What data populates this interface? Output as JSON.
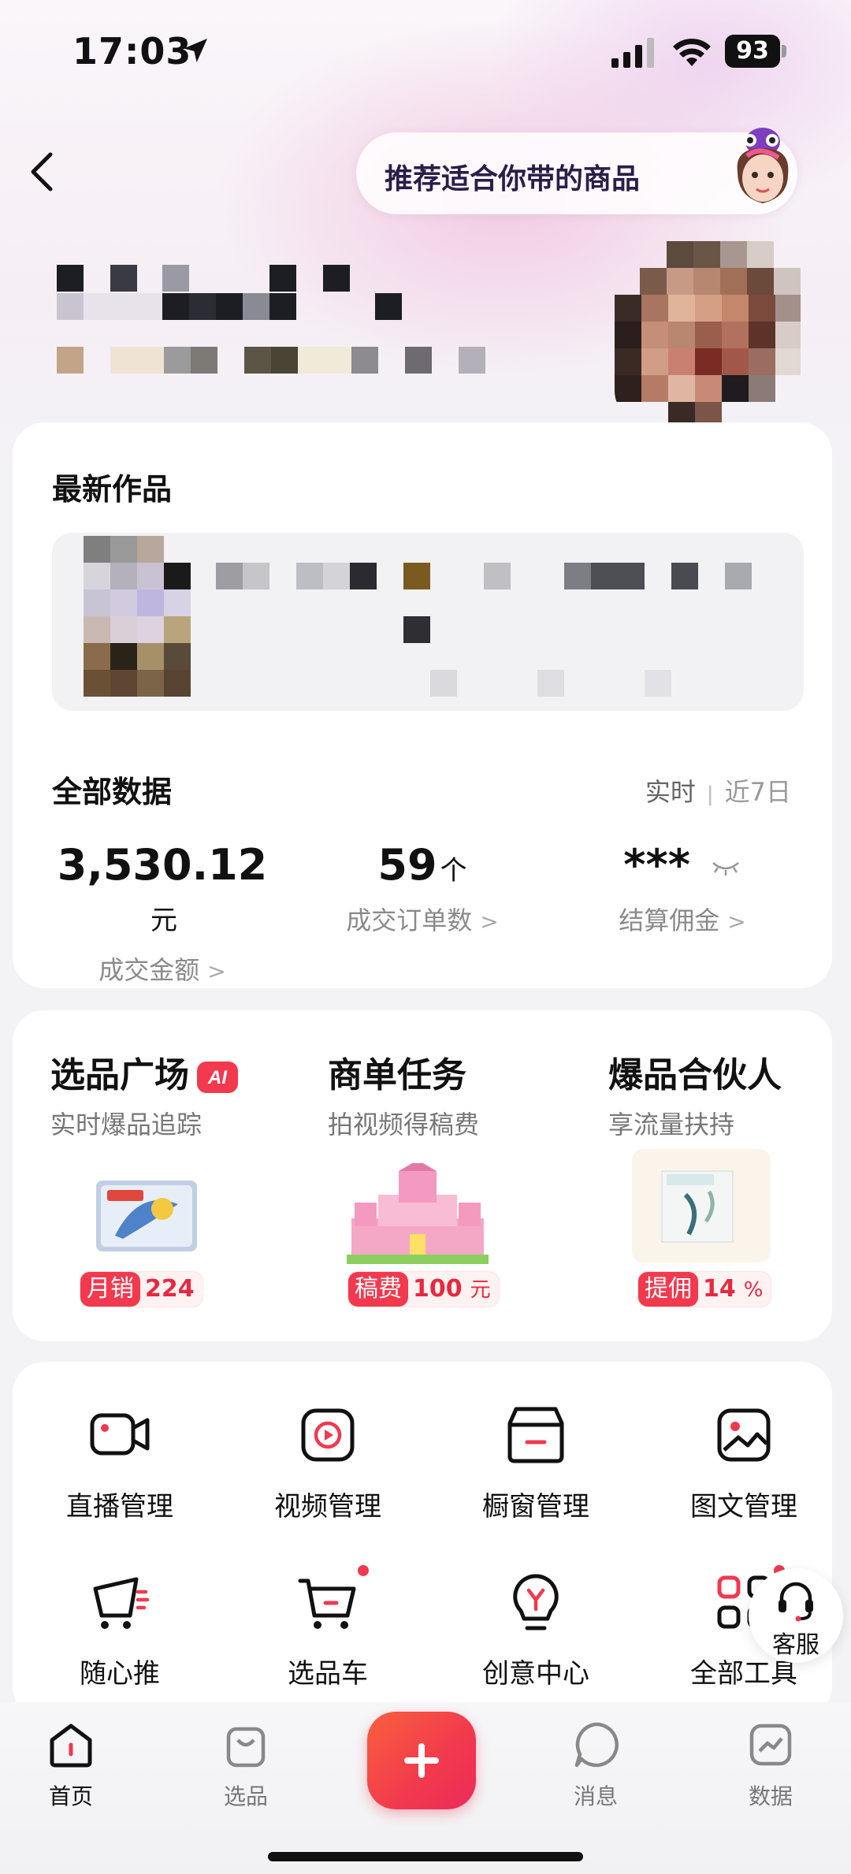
{
  "status_bar": {
    "time": "17:03",
    "battery": "93"
  },
  "header": {
    "recommend_text": "推荐适合你带的商品"
  },
  "works": {
    "title": "最新作品"
  },
  "data_section": {
    "title": "全部数据",
    "tab_realtime": "实时",
    "tab_7days": "近7日",
    "stats": [
      {
        "value": "3,530.12",
        "unit": "元",
        "label": "成交金额"
      },
      {
        "value": "59",
        "unit": "个",
        "label": "成交订单数"
      },
      {
        "value": "***",
        "unit": "",
        "label": "结算佣金"
      }
    ]
  },
  "promo": [
    {
      "title": "选品广场",
      "badge": "AI",
      "subtitle": "实时爆品追踪",
      "tag_key": "月销",
      "tag_value": "224",
      "tag_unit": ""
    },
    {
      "title": "商单任务",
      "subtitle": "拍视频得稿费",
      "tag_key": "稿费",
      "tag_value": "100",
      "tag_unit": "元"
    },
    {
      "title": "爆品合伙人",
      "subtitle": "享流量扶持",
      "tag_key": "提佣",
      "tag_value": "14",
      "tag_unit": "%"
    }
  ],
  "tools": [
    {
      "label": "直播管理",
      "icon": "camera-icon"
    },
    {
      "label": "视频管理",
      "icon": "play-icon"
    },
    {
      "label": "橱窗管理",
      "icon": "shop-window-icon"
    },
    {
      "label": "图文管理",
      "icon": "image-icon"
    },
    {
      "label": "随心推",
      "icon": "promote-icon"
    },
    {
      "label": "选品车",
      "icon": "cart-icon"
    },
    {
      "label": "创意中心",
      "icon": "bulb-icon"
    },
    {
      "label": "全部工具",
      "icon": "grid-icon"
    }
  ],
  "service": {
    "label": "客服"
  },
  "nav": {
    "home": "首页",
    "select": "选品",
    "messages": "消息",
    "data": "数据"
  },
  "colors": {
    "accent": "#f2394e",
    "text": "#111111",
    "muted": "#8a8a8a"
  }
}
